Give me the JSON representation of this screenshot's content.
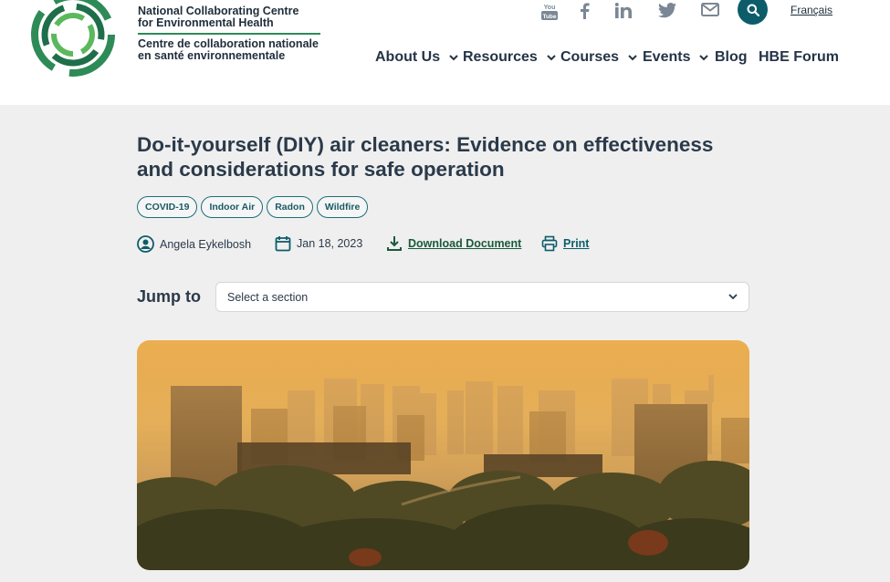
{
  "header": {
    "org_en_line1": "National Collaborating Centre",
    "org_en_line2": "for Environmental Health",
    "org_fr_line1": "Centre de collaboration nationale",
    "org_fr_line2": "en santé environnementale",
    "language_link": "Français",
    "social_icons": [
      "youtube-icon",
      "facebook-icon",
      "linkedin-icon",
      "twitter-icon",
      "email-icon"
    ],
    "youtube_text_top": "You",
    "youtube_text_bottom": "Tube"
  },
  "nav": {
    "items": [
      {
        "label": "About Us",
        "has_dropdown": true
      },
      {
        "label": "Resources",
        "has_dropdown": true
      },
      {
        "label": "Courses",
        "has_dropdown": true
      },
      {
        "label": "Events",
        "has_dropdown": true
      },
      {
        "label": "Blog",
        "has_dropdown": false
      },
      {
        "label": "HBE Forum",
        "has_dropdown": false
      }
    ]
  },
  "article": {
    "title_line1": "Do-it-yourself (DIY) air cleaners: Evidence on effectiveness",
    "title_line2": "and considerations for safe operation",
    "tags": [
      "COVID-19",
      "Indoor Air",
      "Radon",
      "Wildfire"
    ],
    "author": "Angela Eykelbosh",
    "date": "Jan 18, 2023",
    "download_label": "Download Document",
    "print_label": "Print"
  },
  "jump": {
    "label": "Jump to",
    "selected": "Select a section"
  },
  "colors": {
    "brand_teal": "#0d5c6a",
    "brand_green": "#2e8b57",
    "page_bg": "#efefef"
  }
}
